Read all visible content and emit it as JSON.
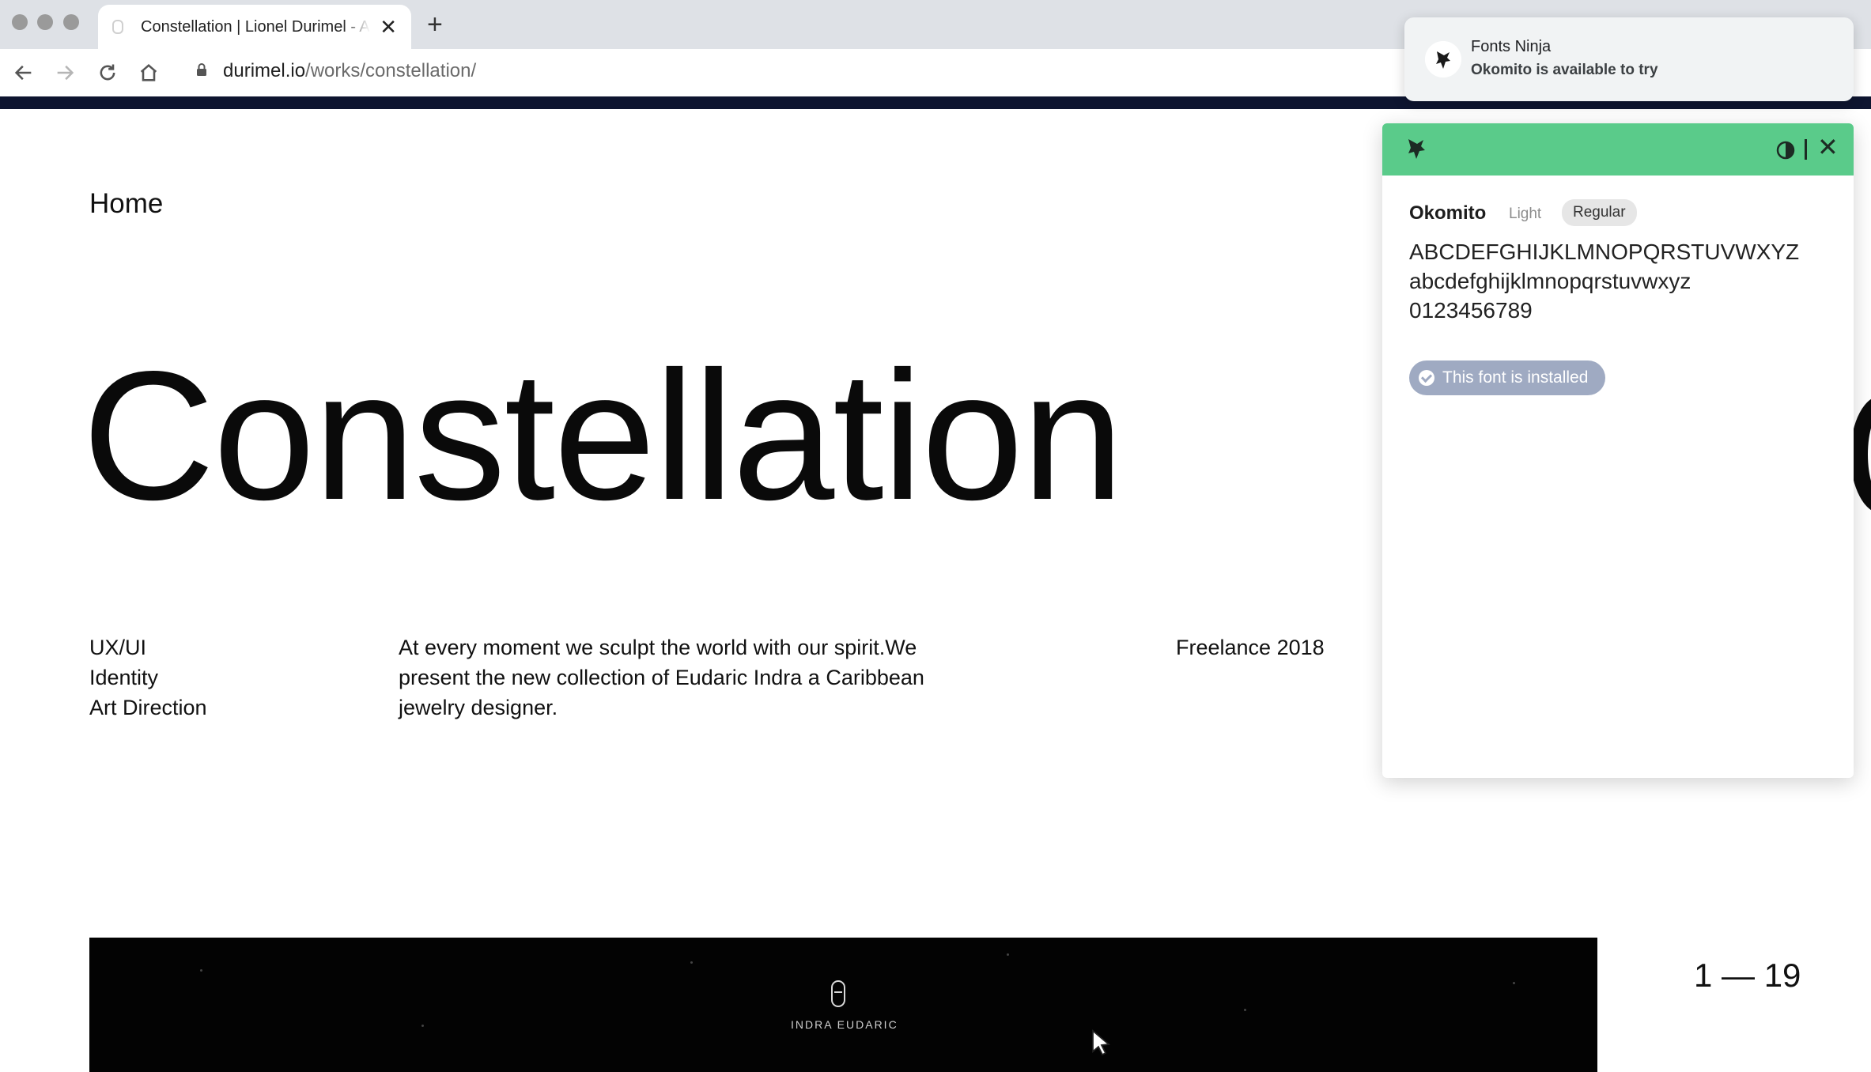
{
  "browser": {
    "tab_title": "Constellation | Lionel Durimel - A",
    "tab_close": "✕",
    "new_tab": "+",
    "url_domain": "durimel.io",
    "url_path": "/works/constellation/"
  },
  "page": {
    "home_link": "Home",
    "hero_title": "Constellation",
    "services": [
      "UX/UI",
      "Identity",
      "Art Direction"
    ],
    "description": "At every moment we sculpt the world with our spirit.We present the new collection of Eudaric Indra a Caribbean jewelry designer.",
    "meta": "Freelance 2018",
    "showcase_brand": "INDRA EUDARIC",
    "counter": "1 — 19"
  },
  "notification": {
    "title": "Fonts Ninja",
    "body": "Okomito is available to try"
  },
  "fonts_panel": {
    "font_name": "Okomito",
    "weights": [
      "Light",
      "Regular"
    ],
    "selected_weight": "Regular",
    "specimen_upper": "ABCDEFGHIJKLMNOPQRSTUVWXYZ",
    "specimen_lower": "abcdefghijklmnopqrstuvwxyz",
    "specimen_digits": "0123456789",
    "installed_label": "This font is installed",
    "close": "✕"
  },
  "colors": {
    "panel_header": "#5acb8a",
    "topbar_rule": "#0e1530",
    "installed_badge": "#9faac2"
  },
  "icons": [
    "ninja-logo-icon",
    "theme-toggle-icon",
    "close-icon",
    "lock-icon",
    "back-icon",
    "forward-icon",
    "reload-icon",
    "home-icon",
    "check-circle-icon",
    "cursor-icon"
  ]
}
